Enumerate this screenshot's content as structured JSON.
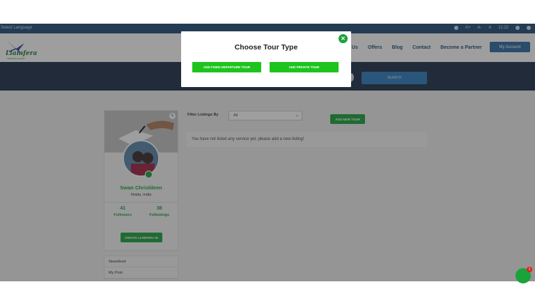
{
  "topbar": {
    "language": "Select Language",
    "font_sizes": [
      "A+",
      "A-",
      "A"
    ],
    "time": "11:22"
  },
  "header": {
    "logo_text": "Liamfera",
    "logo_tagline": "traveling by senses",
    "nav": [
      "Us",
      "Offers",
      "Blog",
      "Contact",
      "Become a Partner"
    ],
    "account_label": "My Account"
  },
  "hero": {
    "search_label": "SEARCH"
  },
  "profile": {
    "name": "Swan Christileen",
    "location": "Noida, India",
    "followers_count": "41",
    "followers_label": "Followers",
    "followings_count": "38",
    "followings_label": "Followings",
    "create_id_label": "CREATE LIAMFERA ID"
  },
  "side_menu": [
    "Newsfeed",
    "My Post"
  ],
  "listings": {
    "filter_label": "Filter Listings By",
    "filter_value": "All",
    "add_new_label": "ADD NEW TOUR",
    "empty_message": "You have not listed any service yet, please add a new listing!"
  },
  "modal": {
    "title": "Choose Tour Type",
    "fixed_departure_label": "ADD FIXED DEPARTURE TOUR",
    "private_label": "ADD PRIVATE TOUR"
  },
  "chat": {
    "badge_count": "1"
  },
  "colors": {
    "brand_green": "#1aa33b",
    "modal_button_green": "#1ec41e",
    "navy": "#1f4e79",
    "hero_bg": "#1c2e4a"
  },
  "icons": [
    "close-icon",
    "edit-icon",
    "camera-icon",
    "chat-icon",
    "user-icon",
    "chevron-down-icon"
  ]
}
